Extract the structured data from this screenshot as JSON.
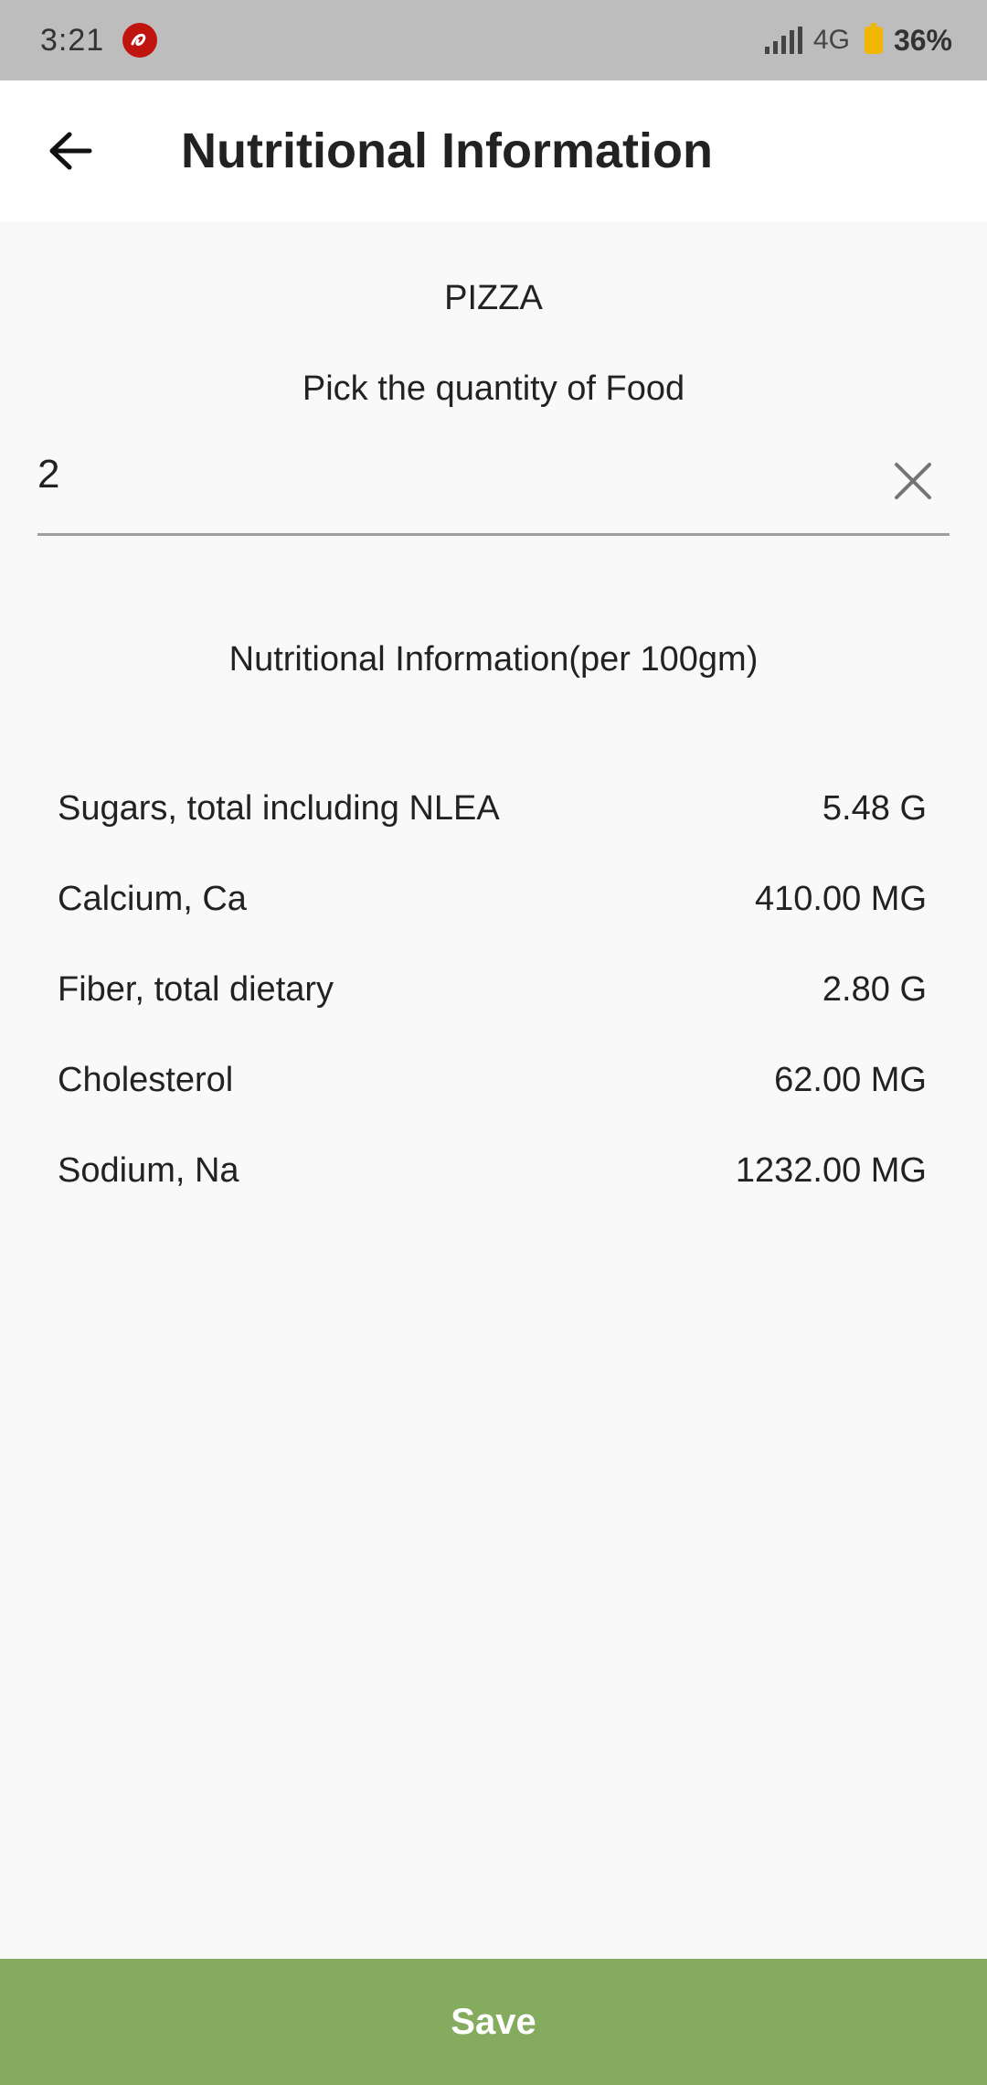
{
  "status_bar": {
    "time": "3:21",
    "network": "4G",
    "battery": "36%",
    "battery_color": "#f2b705",
    "notification_icon": "airtel-icon"
  },
  "app_bar": {
    "title": "Nutritional Information",
    "back_icon": "arrow-left-icon"
  },
  "food": {
    "name": "PIZZA",
    "quantity_prompt": "Pick the quantity of Food",
    "quantity_value": "2"
  },
  "nutrition": {
    "heading": "Nutritional Information(per 100gm)",
    "items": [
      {
        "label": "Sugars, total including NLEA",
        "value": "5.48 G"
      },
      {
        "label": "Calcium, Ca",
        "value": "410.00 MG"
      },
      {
        "label": "Fiber, total dietary",
        "value": "2.80 G"
      },
      {
        "label": "Cholesterol",
        "value": "62.00 MG"
      },
      {
        "label": "Sodium, Na",
        "value": "1232.00 MG"
      }
    ]
  },
  "actions": {
    "save_label": "Save",
    "save_color": "#84ab5e"
  }
}
